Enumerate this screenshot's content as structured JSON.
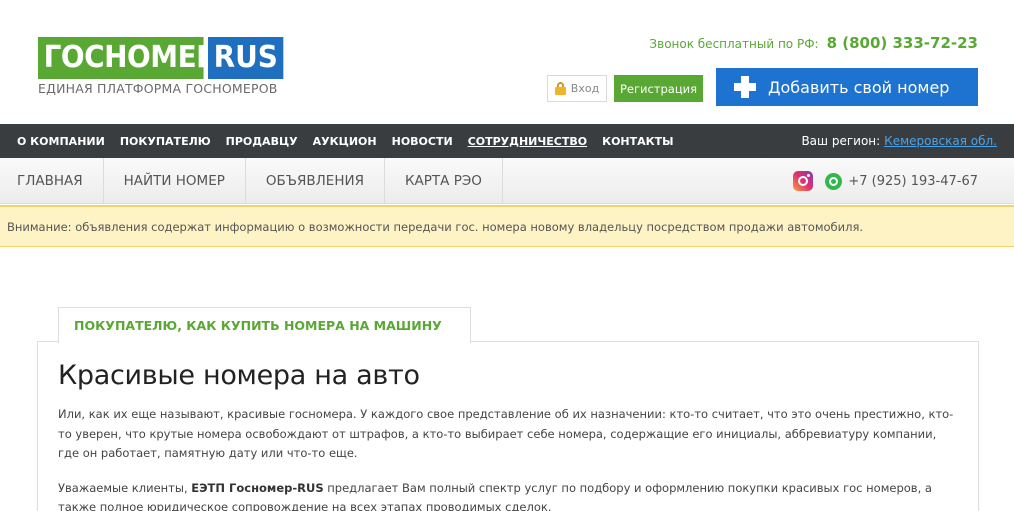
{
  "header": {
    "logo_main": "ГОСНОМЕР",
    "logo_suffix": "RUS",
    "tagline": "ЕДИНАЯ ПЛАТФОРМА ГОСНОМЕРОВ",
    "hotline_label": "Звонок бесплатный по РФ:",
    "hotline_phone": "8 (800) 333-72-23",
    "login_label": "Вход",
    "register_label": "Регистрация",
    "add_number_label": "Добавить свой номер"
  },
  "topnav": {
    "items": [
      "О КОМПАНИИ",
      "ПОКУПАТЕЛЮ",
      "ПРОДАВЦУ",
      "АУКЦИОН",
      "НОВОСТИ",
      "СОТРУДНИЧЕСТВО",
      "КОНТАКТЫ"
    ],
    "region_label": "Ваш регион:",
    "region_value": "Кемеровская обл."
  },
  "subnav": {
    "items": [
      "ГЛАВНАЯ",
      "НАЙТИ НОМЕР",
      "ОБЪЯВЛЕНИЯ",
      "КАРТА РЭО"
    ],
    "phone": "+7 (925) 193-47-67"
  },
  "notice": "Внимание: объявления содержат информацию о возможности передачи гос. номера новому владельцу посредством продажи автомобиля.",
  "main": {
    "tab_label": "ПОКУПАТЕЛЮ, КАК КУПИТЬ НОМЕРА НА МАШИНУ",
    "title": "Красивые номера на авто",
    "paragraph1": "Или, как их еще называют, красивые госномера. У каждого свое представление об их назначении: кто-то считает, что это очень престижно, кто-то уверен, что крутые номера освобождают от штрафов, а кто-то выбирает себе номера, содержащие его инициалы, аббревиатуру компании, где он работает, памятную дату или что-то еще.",
    "paragraph2_start": "Уважаемые клиенты, ",
    "paragraph2_bold": "ЕЭТП Госномер-RUS",
    "paragraph2_end": " предлагает Вам полный спектр услуг по подбору и оформлению покупки красивых гос номеров, а также полное юридическое сопровождение на всех этапах проводимых сделок."
  },
  "colors": {
    "brand_green": "#5aa834",
    "brand_blue": "#1e6fbf",
    "nav_dark": "#3a3d40",
    "notice_bg": "#fdf3c4"
  }
}
